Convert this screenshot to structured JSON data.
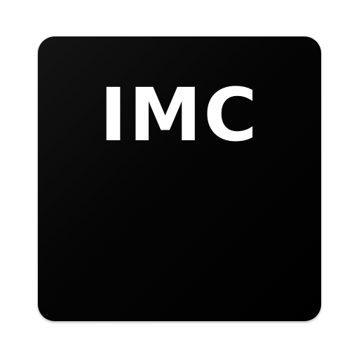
{
  "icon": {
    "label": "IMC",
    "background_color": "#000000",
    "text_color": "#ffffff"
  }
}
